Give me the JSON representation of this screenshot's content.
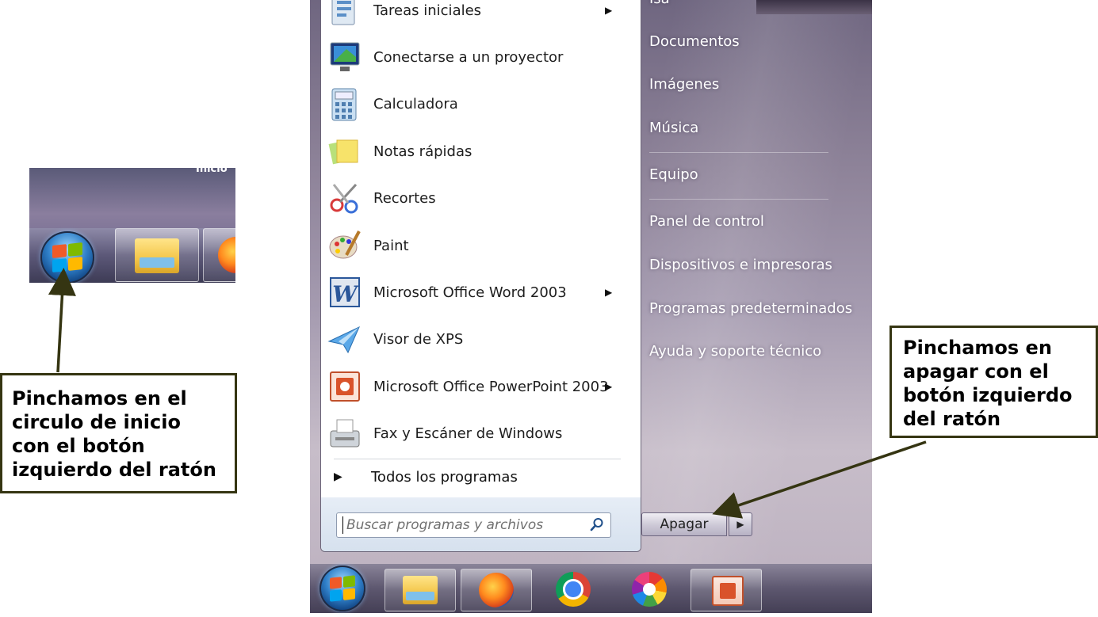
{
  "snippet": {
    "partial_text": "Inicio"
  },
  "callouts": {
    "left": "Pinchamos en el\ncirculo de inicio\ncon el botón\nizquierdo del ratón",
    "right": "Pinchamos en\napagar con el\nbotón izquierdo\ndel ratón"
  },
  "start_menu": {
    "programs": [
      {
        "label": "Tareas iniciales",
        "icon": "getting-started-icon",
        "submenu": true
      },
      {
        "label": "Conectarse a un proyector",
        "icon": "projector-icon",
        "submenu": false
      },
      {
        "label": "Calculadora",
        "icon": "calculator-icon",
        "submenu": false
      },
      {
        "label": "Notas rápidas",
        "icon": "sticky-notes-icon",
        "submenu": false
      },
      {
        "label": "Recortes",
        "icon": "snipping-tool-icon",
        "submenu": false
      },
      {
        "label": "Paint",
        "icon": "paint-icon",
        "submenu": false
      },
      {
        "label": "Microsoft Office Word 2003",
        "icon": "word-icon",
        "submenu": true
      },
      {
        "label": "Visor de XPS",
        "icon": "xps-viewer-icon",
        "submenu": false
      },
      {
        "label": "Microsoft Office PowerPoint 2003",
        "icon": "powerpoint-icon",
        "submenu": true
      },
      {
        "label": "Fax y Escáner de Windows",
        "icon": "fax-scanner-icon",
        "submenu": false
      }
    ],
    "submenu_glyph": "▶",
    "all_programs": {
      "label": "Todos los programas",
      "glyph": "▶"
    },
    "search": {
      "placeholder": "Buscar programas y archivos"
    },
    "right_items": {
      "user": "Isa",
      "documents": "Documentos",
      "pictures": "Imágenes",
      "music": "Música",
      "computer": "Equipo",
      "control_panel": "Panel de control",
      "devices": "Dispositivos e impresoras",
      "default_programs": "Programas predeterminados",
      "help": "Ayuda y soporte técnico"
    },
    "shutdown": {
      "label": "Apagar",
      "arrow": "▶"
    }
  },
  "taskbar_icons": [
    "start-orb",
    "explorer-icon",
    "firefox-icon",
    "chrome-icon",
    "picasa-icon",
    "powerpoint-icon"
  ],
  "colors": {
    "callout_border": "#353512",
    "arrow": "#353512",
    "menu_white": "#ffffff"
  }
}
